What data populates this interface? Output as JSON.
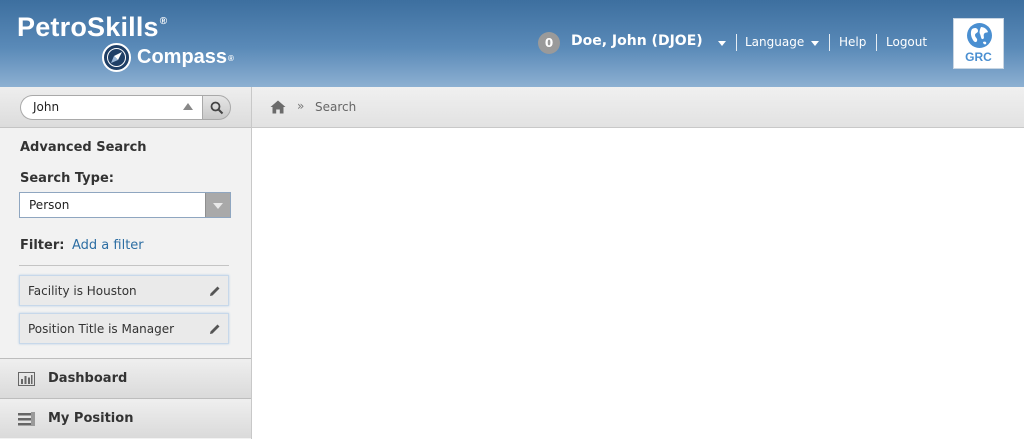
{
  "header": {
    "brand": "PetroSkills",
    "brand_mark": "®",
    "product": "Compass",
    "product_mark": "®",
    "notification_count": "0",
    "user_name": "Doe, John (DJOE)",
    "links": {
      "language": "Language",
      "help": "Help",
      "logout": "Logout"
    },
    "grc_label": "GRC"
  },
  "sidebar": {
    "search_value": "John",
    "advanced_title": "Advanced Search",
    "search_type_label": "Search Type:",
    "search_type_value": "Person",
    "filter_label": "Filter:",
    "add_filter_link": "Add a filter",
    "filters": [
      {
        "label": "Facility is Houston"
      },
      {
        "label": "Position Title is Manager"
      }
    ],
    "nav": [
      {
        "label": "Dashboard",
        "icon": "bar-chart-icon"
      },
      {
        "label": "My Position",
        "icon": "list-icon"
      }
    ]
  },
  "breadcrumb": {
    "separator": "»",
    "current": "Search"
  },
  "colors": {
    "header_top": "#3d6f9f",
    "header_bottom": "#8db0d2",
    "link": "#2d6ea3",
    "grc_blue": "#4a8fd1"
  }
}
